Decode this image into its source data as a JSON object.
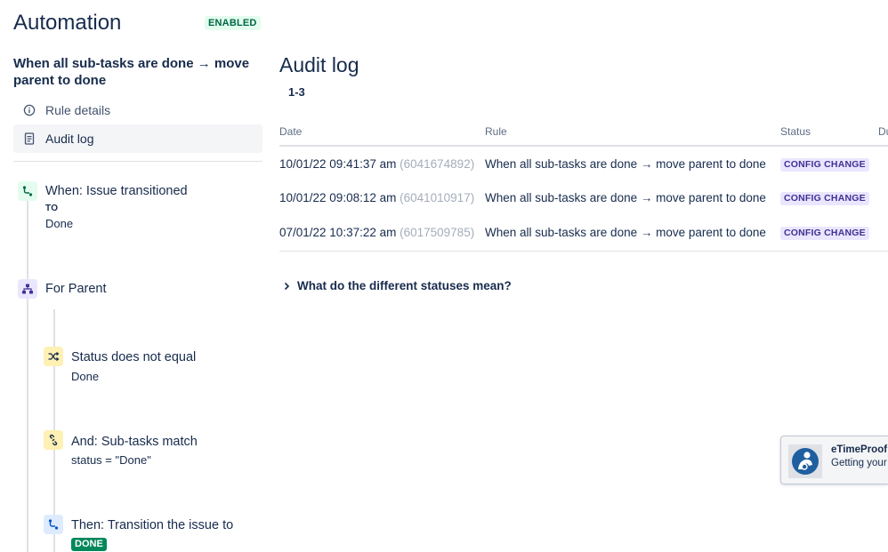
{
  "app": {
    "title": "Automation",
    "status_badge": "ENABLED"
  },
  "rule": {
    "name": "When all sub-tasks are done → move parent to done"
  },
  "sidebar": {
    "nav": [
      {
        "label": "Rule details",
        "icon": "info-icon"
      },
      {
        "label": "Audit log",
        "icon": "document-icon",
        "active": true
      }
    ],
    "components": {
      "trigger": {
        "title": "When: Issue transitioned",
        "to_label": "TO",
        "value": "Done",
        "icon": "transition-icon"
      },
      "branch": {
        "title": "For Parent",
        "icon": "hierarchy-icon"
      },
      "condition1": {
        "title": "Status does not equal",
        "value": "Done",
        "icon": "shuffle-icon"
      },
      "condition2": {
        "title": "And: Sub-tasks match",
        "value": "status = \"Done\"",
        "icon": "link-icon"
      },
      "action": {
        "title": "Then: Transition the issue to",
        "badge": "DONE",
        "icon": "transition-icon"
      }
    }
  },
  "main": {
    "title": "Audit log",
    "range": "1-3",
    "columns": [
      "Date",
      "Rule",
      "Status",
      "Du"
    ],
    "rows": [
      {
        "date": "10/01/22 09:41:37 am",
        "id": "(6041674892)",
        "rule": "When all sub-tasks are done → move parent to done",
        "status": "CONFIG CHANGE"
      },
      {
        "date": "10/01/22 09:08:12 am",
        "id": "(6041010917)",
        "rule": "When all sub-tasks are done → move parent to done",
        "status": "CONFIG CHANGE"
      },
      {
        "date": "07/01/22 10:37:22 am",
        "id": "(6017509785)",
        "rule": "When all sub-tasks are done → move parent to done",
        "status": "CONFIG CHANGE"
      }
    ],
    "expander": "What do the different statuses mean?"
  },
  "promo": {
    "name": "eTimeProof",
    "subtitle": "Getting your"
  },
  "colors": {
    "text": "#172b4d",
    "enabled_bg": "#e3fcef",
    "enabled_text": "#006644",
    "status_bg": "#eae6ff",
    "status_text": "#403294",
    "done_bg": "#00875a"
  }
}
